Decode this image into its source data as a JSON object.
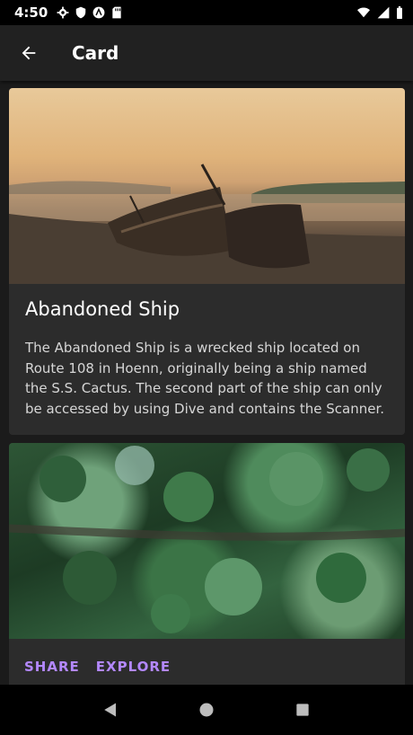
{
  "status_bar": {
    "time": "4:50"
  },
  "app_bar": {
    "title": "Card"
  },
  "cards": [
    {
      "title": "Abandoned Ship",
      "body": "The Abandoned Ship is a wrecked ship located on Route 108 in Hoenn, originally being a ship named the S.S. Cactus. The second part of the ship can only be accessed by using Dive and contains the Scanner."
    },
    {
      "actions": [
        "SHARE",
        "EXPLORE"
      ]
    }
  ],
  "colors": {
    "accent": "#b388ff",
    "app_bar": "#212121",
    "card": "#2c2c2c",
    "background": "#1b1b1b"
  }
}
